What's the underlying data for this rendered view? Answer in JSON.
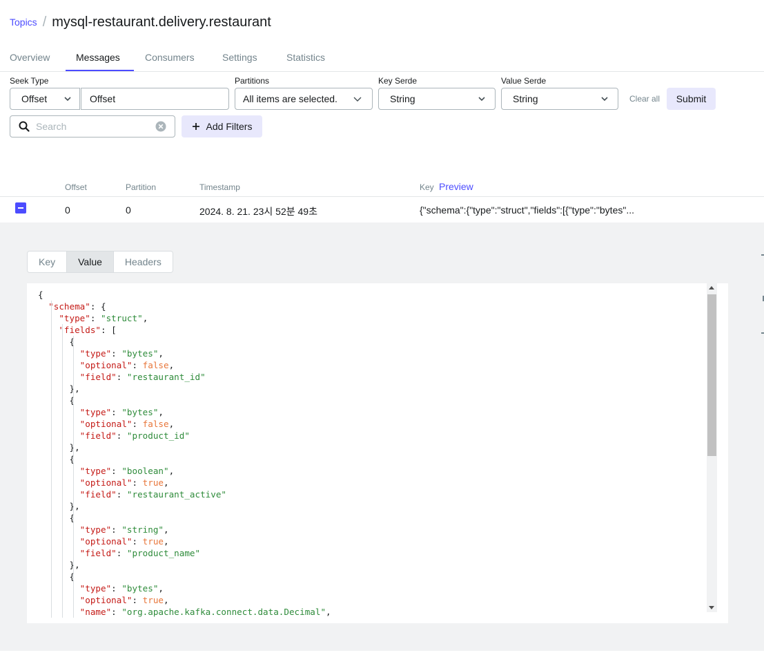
{
  "breadcrumb": {
    "parent": "Topics",
    "separator": "/",
    "title": "mysql-restaurant.delivery.restaurant"
  },
  "tabs": [
    "Overview",
    "Messages",
    "Consumers",
    "Settings",
    "Statistics"
  ],
  "active_tab": "Messages",
  "filters": {
    "seek_type_label": "Seek Type",
    "seek_type_value": "Offset",
    "offset_value": "Offset",
    "partitions_label": "Partitions",
    "partitions_value": "All items are selected.",
    "key_serde_label": "Key Serde",
    "key_serde_value": "String",
    "value_serde_label": "Value Serde",
    "value_serde_value": "String",
    "clear_all": "Clear all",
    "submit": "Submit",
    "search_placeholder": "Search",
    "add_filters": "Add Filters"
  },
  "table": {
    "columns": {
      "offset": "Offset",
      "partition": "Partition",
      "timestamp": "Timestamp",
      "key": "Key",
      "preview": "Preview"
    },
    "row": {
      "offset": "0",
      "partition": "0",
      "timestamp": "2024. 8. 21. 23시 52분 49초",
      "key": "{\"schema\":{\"type\":\"struct\",\"fields\":[{\"type\":\"bytes\"..."
    }
  },
  "detail": {
    "subtabs": [
      "Key",
      "Value",
      "Headers"
    ],
    "active_subtab": "Value",
    "code_lines": [
      [
        [
          "p",
          "{"
        ]
      ],
      [
        [
          "p",
          "  "
        ],
        [
          "k",
          "\"schema\""
        ],
        [
          "p",
          ": {"
        ]
      ],
      [
        [
          "p",
          "    "
        ],
        [
          "k",
          "\"type\""
        ],
        [
          "p",
          ": "
        ],
        [
          "s",
          "\"struct\""
        ],
        [
          "p",
          ","
        ]
      ],
      [
        [
          "p",
          "    "
        ],
        [
          "k",
          "\"fields\""
        ],
        [
          "p",
          ": ["
        ]
      ],
      [
        [
          "p",
          "      {"
        ]
      ],
      [
        [
          "p",
          "        "
        ],
        [
          "k",
          "\"type\""
        ],
        [
          "p",
          ": "
        ],
        [
          "s",
          "\"bytes\""
        ],
        [
          "p",
          ","
        ]
      ],
      [
        [
          "p",
          "        "
        ],
        [
          "k",
          "\"optional\""
        ],
        [
          "p",
          ": "
        ],
        [
          "b",
          "false"
        ],
        [
          "p",
          ","
        ]
      ],
      [
        [
          "p",
          "        "
        ],
        [
          "k",
          "\"field\""
        ],
        [
          "p",
          ": "
        ],
        [
          "s",
          "\"restaurant_id\""
        ]
      ],
      [
        [
          "p",
          "      },"
        ]
      ],
      [
        [
          "p",
          "      {"
        ]
      ],
      [
        [
          "p",
          "        "
        ],
        [
          "k",
          "\"type\""
        ],
        [
          "p",
          ": "
        ],
        [
          "s",
          "\"bytes\""
        ],
        [
          "p",
          ","
        ]
      ],
      [
        [
          "p",
          "        "
        ],
        [
          "k",
          "\"optional\""
        ],
        [
          "p",
          ": "
        ],
        [
          "b",
          "false"
        ],
        [
          "p",
          ","
        ]
      ],
      [
        [
          "p",
          "        "
        ],
        [
          "k",
          "\"field\""
        ],
        [
          "p",
          ": "
        ],
        [
          "s",
          "\"product_id\""
        ]
      ],
      [
        [
          "p",
          "      },"
        ]
      ],
      [
        [
          "p",
          "      {"
        ]
      ],
      [
        [
          "p",
          "        "
        ],
        [
          "k",
          "\"type\""
        ],
        [
          "p",
          ": "
        ],
        [
          "s",
          "\"boolean\""
        ],
        [
          "p",
          ","
        ]
      ],
      [
        [
          "p",
          "        "
        ],
        [
          "k",
          "\"optional\""
        ],
        [
          "p",
          ": "
        ],
        [
          "b",
          "true"
        ],
        [
          "p",
          ","
        ]
      ],
      [
        [
          "p",
          "        "
        ],
        [
          "k",
          "\"field\""
        ],
        [
          "p",
          ": "
        ],
        [
          "s",
          "\"restaurant_active\""
        ]
      ],
      [
        [
          "p",
          "      },"
        ]
      ],
      [
        [
          "p",
          "      {"
        ]
      ],
      [
        [
          "p",
          "        "
        ],
        [
          "k",
          "\"type\""
        ],
        [
          "p",
          ": "
        ],
        [
          "s",
          "\"string\""
        ],
        [
          "p",
          ","
        ]
      ],
      [
        [
          "p",
          "        "
        ],
        [
          "k",
          "\"optional\""
        ],
        [
          "p",
          ": "
        ],
        [
          "b",
          "true"
        ],
        [
          "p",
          ","
        ]
      ],
      [
        [
          "p",
          "        "
        ],
        [
          "k",
          "\"field\""
        ],
        [
          "p",
          ": "
        ],
        [
          "s",
          "\"product_name\""
        ]
      ],
      [
        [
          "p",
          "      },"
        ]
      ],
      [
        [
          "p",
          "      {"
        ]
      ],
      [
        [
          "p",
          "        "
        ],
        [
          "k",
          "\"type\""
        ],
        [
          "p",
          ": "
        ],
        [
          "s",
          "\"bytes\""
        ],
        [
          "p",
          ","
        ]
      ],
      [
        [
          "p",
          "        "
        ],
        [
          "k",
          "\"optional\""
        ],
        [
          "p",
          ": "
        ],
        [
          "b",
          "true"
        ],
        [
          "p",
          ","
        ]
      ],
      [
        [
          "p",
          "        "
        ],
        [
          "k",
          "\"name\""
        ],
        [
          "p",
          ": "
        ],
        [
          "s",
          "\"org.apache.kafka.connect.data.Decimal\""
        ],
        [
          "p",
          ","
        ]
      ]
    ]
  },
  "colors": {
    "accent": "#4c4cff",
    "json_key": "#c41a16",
    "json_string": "#2e8b3a",
    "json_literal": "#e8763a"
  }
}
